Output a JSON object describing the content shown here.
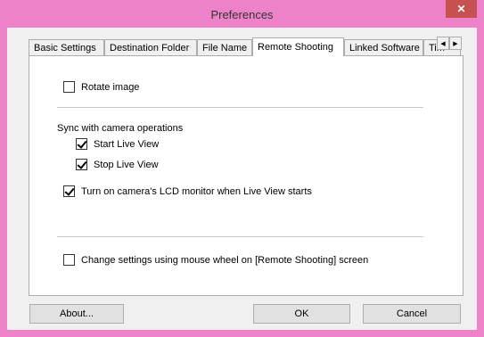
{
  "window": {
    "title": "Preferences",
    "close_glyph": "✕",
    "accent_color": "#ee82c8"
  },
  "tabs": [
    {
      "label": "Basic Settings"
    },
    {
      "label": "Destination Folder"
    },
    {
      "label": "File Name"
    },
    {
      "label": "Remote Shooting",
      "active": true
    },
    {
      "label": "Linked Software"
    },
    {
      "label": "Tim"
    }
  ],
  "tab_scroll": {
    "left_glyph": "◀",
    "right_glyph": "▶"
  },
  "panel": {
    "rotate_image": {
      "label": "Rotate image",
      "checked": false
    },
    "sync_heading": "Sync with camera operations",
    "start_live_view": {
      "label": "Start Live View",
      "checked": true
    },
    "stop_live_view": {
      "label": "Stop Live View",
      "checked": true
    },
    "lcd_monitor": {
      "label": "Turn on camera's LCD monitor when Live View starts",
      "checked": true
    },
    "mouse_wheel": {
      "label": "Change settings using mouse wheel on [Remote Shooting] screen",
      "checked": false
    }
  },
  "buttons": {
    "about": "About...",
    "ok": "OK",
    "cancel": "Cancel"
  }
}
